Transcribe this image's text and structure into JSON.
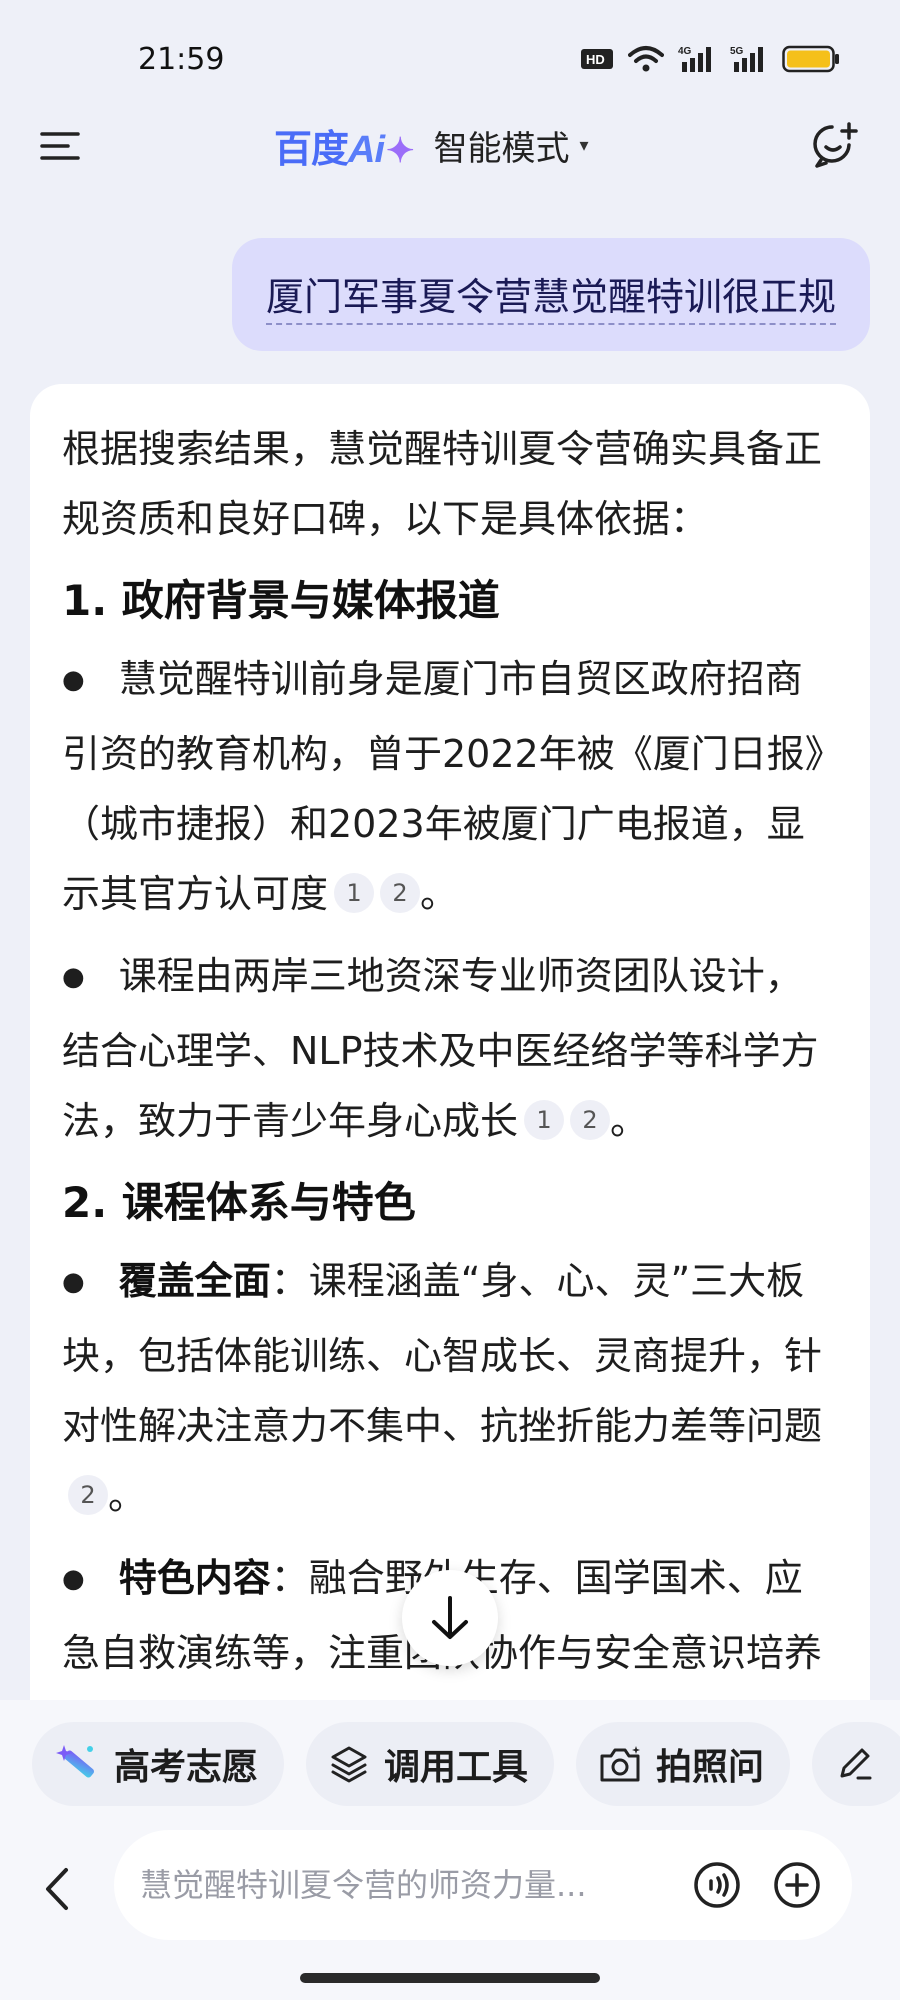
{
  "status_bar": {
    "time": "21:59",
    "icons": [
      "hd-icon",
      "wifi-icon",
      "4g-signal-icon",
      "5g-signal-icon",
      "battery-icon"
    ],
    "hd_label": "HD",
    "net1": "4G",
    "net2": "5G"
  },
  "header": {
    "brand_text": "百度",
    "brand_ai": "Ai",
    "brand_star": "✦",
    "mode_label": "智能模式"
  },
  "user_message": "厦门军事夏令营慧觉醒特训很正规",
  "answer": {
    "intro": "根据搜索结果，慧觉醒特训夏令营确实具备正规资质和良好口碑，以下是具体依据：",
    "sections": [
      {
        "title": "1. 政府背景与媒体报道",
        "bullets": [
          {
            "bold": "",
            "text": "慧觉醒特训前身是厦门市自贸区政府招商引资的教育机构，曾于2022年被《厦门日报》（城市捷报）和2023年被厦门广电报道，显示其官方认可度",
            "cites": [
              "1",
              "2"
            ],
            "end": "。"
          },
          {
            "bold": "",
            "text": "课程由两岸三地资深专业师资团队设计，结合心理学、NLP技术及中医经络学等科学方法，致力于青少年身心成长",
            "cites": [
              "1",
              "2"
            ],
            "end": "。"
          }
        ]
      },
      {
        "title": "2. 课程体系与特色",
        "bullets": [
          {
            "bold": "覆盖全面",
            "text": "：课程涵盖“身、心、灵”三大板块，包括体能训练、心智成长、灵商提升，针对性解决注意力不集中、抗挫折能力差等问题",
            "cites": [
              "2"
            ],
            "end": "。"
          },
          {
            "bold": "特色内容",
            "text": "：融合野外生存、国学国术、应急自救演练等，注重团队协作与安全意识培养",
            "cites": [],
            "end": ""
          }
        ]
      }
    ]
  },
  "chips": [
    {
      "label": "高考志愿",
      "icon": "magic-wand-icon"
    },
    {
      "label": "调用工具",
      "icon": "layers-icon"
    },
    {
      "label": "拍照问",
      "icon": "camera-icon"
    }
  ],
  "input": {
    "placeholder": "慧觉醒特训夏令营的师资力量..."
  },
  "colors": {
    "accent": "#4a6cf7",
    "user_bubble": "#dcdcfc",
    "background": "#eef0f8"
  }
}
